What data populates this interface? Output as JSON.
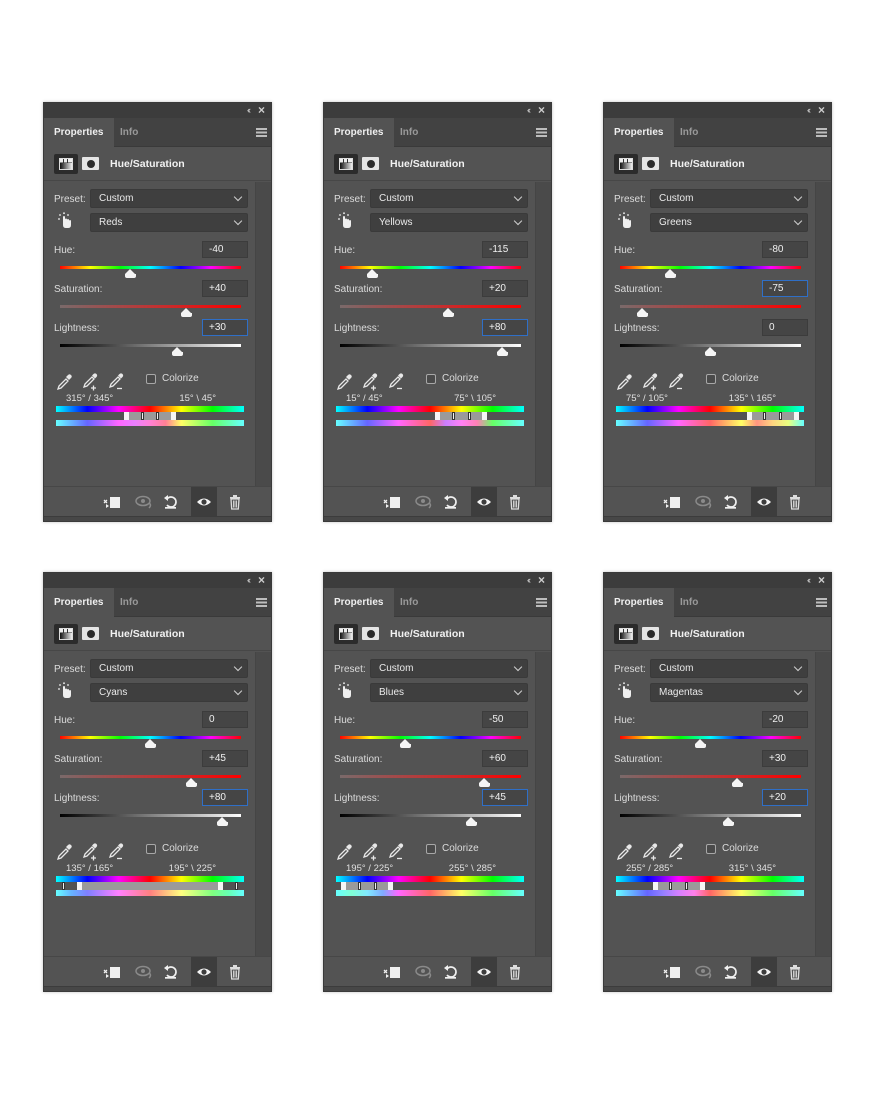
{
  "common": {
    "tab_properties": "Properties",
    "tab_info": "Info",
    "collapse_glyph": "‹‹",
    "close_glyph": "×",
    "adjustment_title": "Hue/Saturation",
    "preset_label": "Preset:",
    "preset_value": "Custom",
    "hue_label": "Hue:",
    "saturation_label": "Saturation:",
    "lightness_label": "Lightness:",
    "colorize_label": "Colorize",
    "colorize_checked": false,
    "icons": {
      "panel_menu": "hamburger-menu-icon",
      "adjustment_layer": "hue-saturation-adjustment-icon",
      "mask": "layer-mask-icon",
      "targeted_adjust": "hand-targeted-adjustment-icon",
      "eyedropper": "eyedropper-icon",
      "eyedropper_add": "eyedropper-add-icon",
      "eyedropper_subtract": "eyedropper-subtract-icon",
      "clip_to_layer": "clip-to-layer-icon",
      "view_previous": "view-previous-state-icon",
      "reset": "reset-icon",
      "visibility": "eye-icon",
      "delete": "trash-icon"
    },
    "slider_ranges": {
      "hue": [
        -180,
        180
      ],
      "saturation": [
        -100,
        100
      ],
      "lightness": [
        -100,
        100
      ]
    }
  },
  "panels": [
    {
      "channel": "Reds",
      "hue": "-40",
      "saturation": "+40",
      "lightness": "+30",
      "hue_value": -40,
      "saturation_value": 40,
      "lightness_value": 30,
      "focused_field": "lightness",
      "range_left": "315° / 345°",
      "range_right": "15° \\ 45°",
      "range_degrees": [
        315,
        345,
        15,
        45
      ]
    },
    {
      "channel": "Yellows",
      "hue": "-115",
      "saturation": "+20",
      "lightness": "+80",
      "hue_value": -115,
      "saturation_value": 20,
      "lightness_value": 80,
      "focused_field": "lightness",
      "range_left": "15° / 45°",
      "range_right": "75° \\ 105°",
      "range_degrees": [
        15,
        45,
        75,
        105
      ]
    },
    {
      "channel": "Greens",
      "hue": "-80",
      "saturation": "-75",
      "lightness": "0",
      "hue_value": -80,
      "saturation_value": -75,
      "lightness_value": 0,
      "focused_field": "saturation",
      "range_left": "75° / 105°",
      "range_right": "135° \\ 165°",
      "range_degrees": [
        75,
        105,
        135,
        165
      ]
    },
    {
      "channel": "Cyans",
      "hue": "0",
      "saturation": "+45",
      "lightness": "+80",
      "hue_value": 0,
      "saturation_value": 45,
      "lightness_value": 80,
      "focused_field": "lightness",
      "range_left": "135° / 165°",
      "range_right": "195° \\ 225°",
      "range_degrees": [
        135,
        165,
        195,
        225
      ]
    },
    {
      "channel": "Blues",
      "hue": "-50",
      "saturation": "+60",
      "lightness": "+45",
      "hue_value": -50,
      "saturation_value": 60,
      "lightness_value": 45,
      "focused_field": "lightness",
      "range_left": "195° / 225°",
      "range_right": "255° \\ 285°",
      "range_degrees": [
        195,
        225,
        255,
        285
      ]
    },
    {
      "channel": "Magentas",
      "hue": "-20",
      "saturation": "+30",
      "lightness": "+20",
      "hue_value": -20,
      "saturation_value": 30,
      "lightness_value": 20,
      "focused_field": "lightness",
      "range_left": "255° / 285°",
      "range_right": "315° \\ 345°",
      "range_degrees": [
        255,
        285,
        315,
        345
      ]
    }
  ]
}
